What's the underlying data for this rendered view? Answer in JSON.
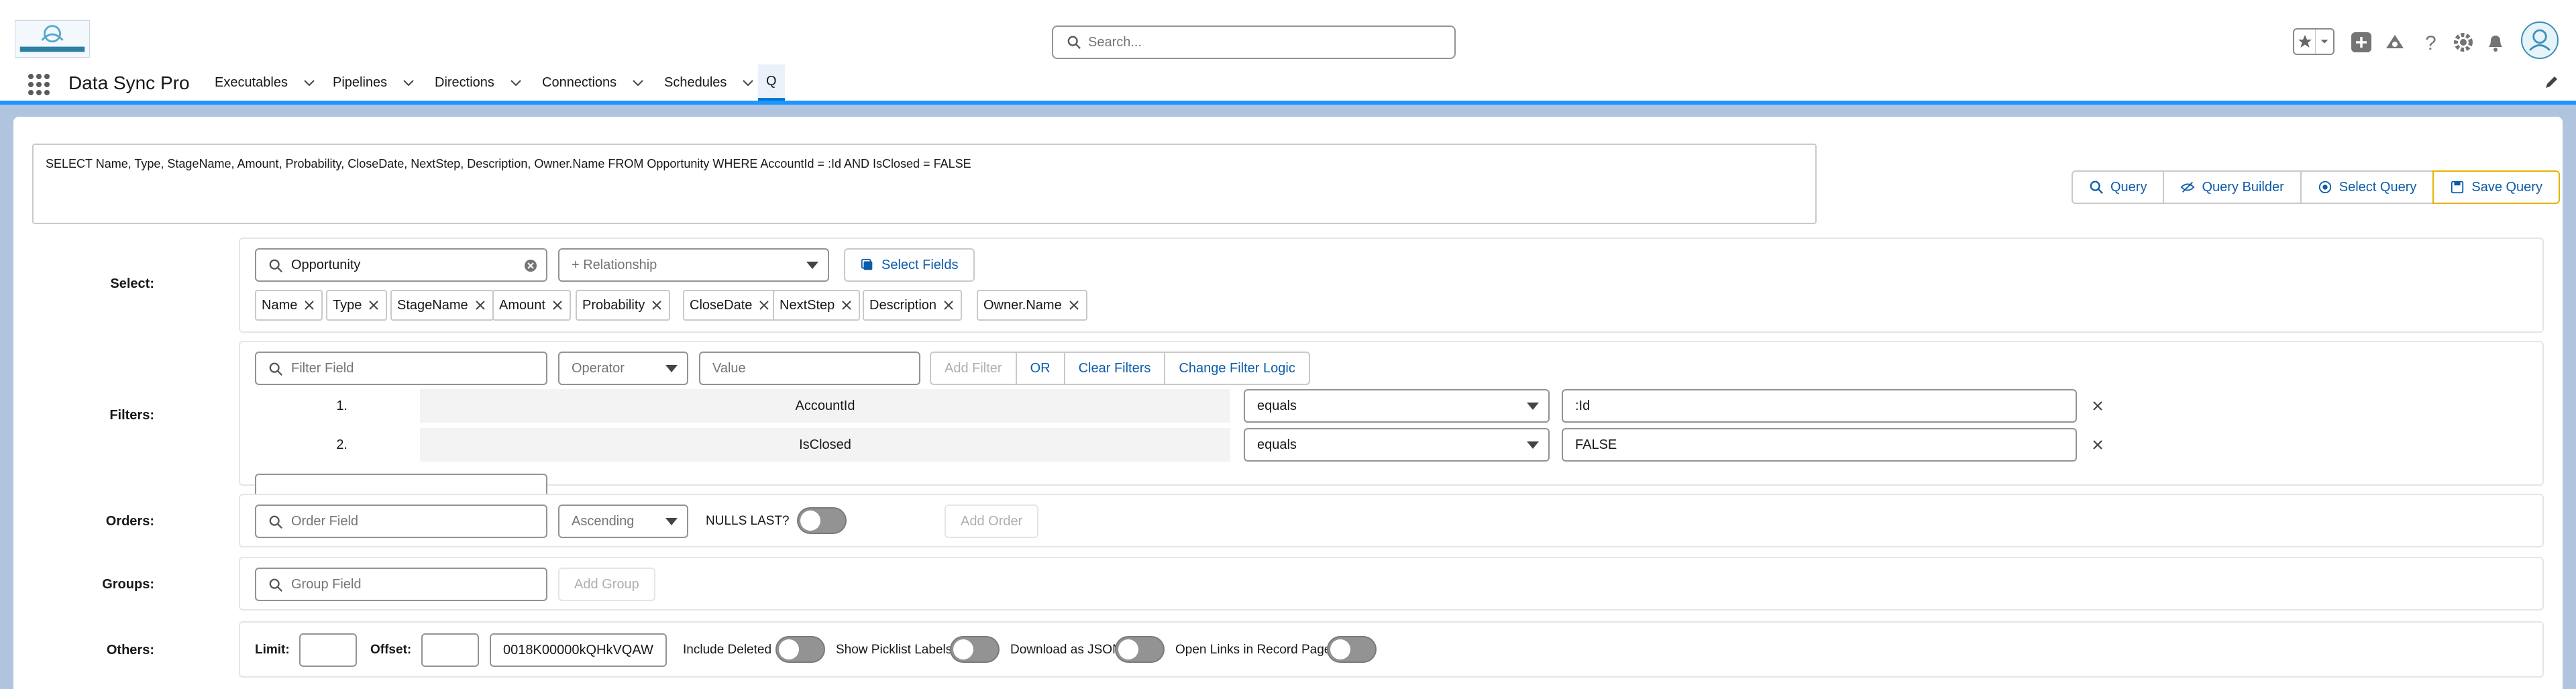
{
  "header": {
    "search_placeholder": "Search...",
    "brand_color": "#0176d3"
  },
  "nav": {
    "app_name": "Data Sync Pro",
    "items": [
      {
        "label": "Executables"
      },
      {
        "label": "Pipelines"
      },
      {
        "label": "Directions"
      },
      {
        "label": "Connections"
      },
      {
        "label": "Schedules"
      },
      {
        "label": "Q"
      }
    ]
  },
  "query": {
    "text": "SELECT Name, Type, StageName, Amount, Probability, CloseDate, NextStep, Description, Owner.Name FROM Opportunity WHERE AccountId = :Id AND IsClosed = FALSE",
    "buttons": {
      "query": "Query",
      "query_builder": "Query Builder",
      "select_query": "Select Query",
      "save_query": "Save Query"
    }
  },
  "select": {
    "label": "Select:",
    "object": "Opportunity",
    "relationship_placeholder": "+ Relationship",
    "select_fields_button": "Select Fields",
    "fields": [
      "Name",
      "Type",
      "StageName",
      "Amount",
      "Probability",
      "CloseDate",
      "NextStep",
      "Description",
      "Owner.Name"
    ]
  },
  "filters": {
    "label": "Filters:",
    "field_placeholder": "Filter Field",
    "operator_placeholder": "Operator",
    "value_placeholder": "Value",
    "add_filter": "Add Filter",
    "or_button": "OR",
    "clear_filters": "Clear Filters",
    "change_logic": "Change Filter Logic",
    "rows": [
      {
        "num": "1.",
        "field": "AccountId",
        "operator": "equals",
        "value": ":Id"
      },
      {
        "num": "2.",
        "field": "IsClosed",
        "operator": "equals",
        "value": "FALSE"
      }
    ]
  },
  "orders": {
    "label": "Orders:",
    "field_placeholder": "Order Field",
    "direction": "Ascending",
    "nulls_last_label": "NULLS LAST?",
    "nulls_last": false,
    "add_order": "Add Order"
  },
  "groups": {
    "label": "Groups:",
    "field_placeholder": "Group Field",
    "add_group": "Add Group"
  },
  "others": {
    "label": "Others:",
    "limit_label": "Limit:",
    "limit_value": "",
    "offset_label": "Offset:",
    "offset_value": "",
    "record_id": "0018K00000kQHkVQAW",
    "include_deleted_label": "Include Deleted",
    "include_deleted": false,
    "show_picklist_labels_label": "Show Picklist Labels",
    "show_picklist_labels": false,
    "download_json_label": "Download as JSON",
    "download_json": false,
    "open_links_label": "Open Links in Record Page",
    "open_links": false
  }
}
